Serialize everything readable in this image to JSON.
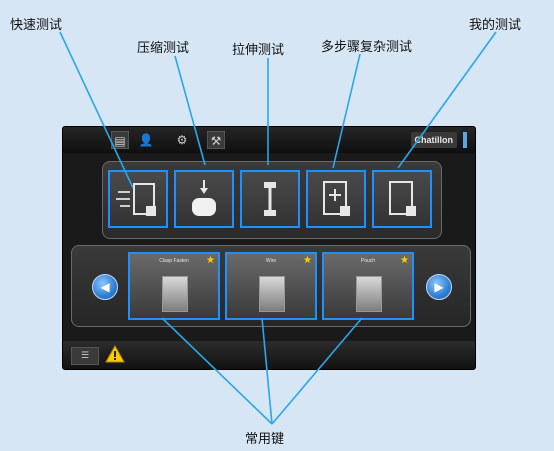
{
  "callouts": {
    "quick_test": "快速测试",
    "compression_test": "压缩测试",
    "tensile_test": "拉伸测试",
    "multi_step_test": "多步骤复杂测试",
    "my_tests": "我的测试",
    "favorites": "常用键"
  },
  "top_bar": {
    "icons": [
      "document-icon",
      "user-icon",
      "settings-icon",
      "tools-icon"
    ],
    "brand": "Chatillon"
  },
  "test_tiles": [
    {
      "name": "quick-test",
      "icon": "quick-test-icon"
    },
    {
      "name": "compression-test",
      "icon": "compression-icon"
    },
    {
      "name": "tensile-test",
      "icon": "tensile-icon"
    },
    {
      "name": "multi-step-test",
      "icon": "multi-step-icon"
    },
    {
      "name": "my-tests",
      "icon": "my-tests-icon"
    }
  ],
  "favorites": [
    {
      "title": "Clasp Fasten",
      "starred": true
    },
    {
      "title": "Wire",
      "starred": true
    },
    {
      "title": "Pouch",
      "starred": true
    }
  ],
  "colors": {
    "accent": "#1e90ff",
    "leader_line": "#2aa6ea",
    "star": "#ffcc00",
    "warning": "#ffcc00"
  }
}
